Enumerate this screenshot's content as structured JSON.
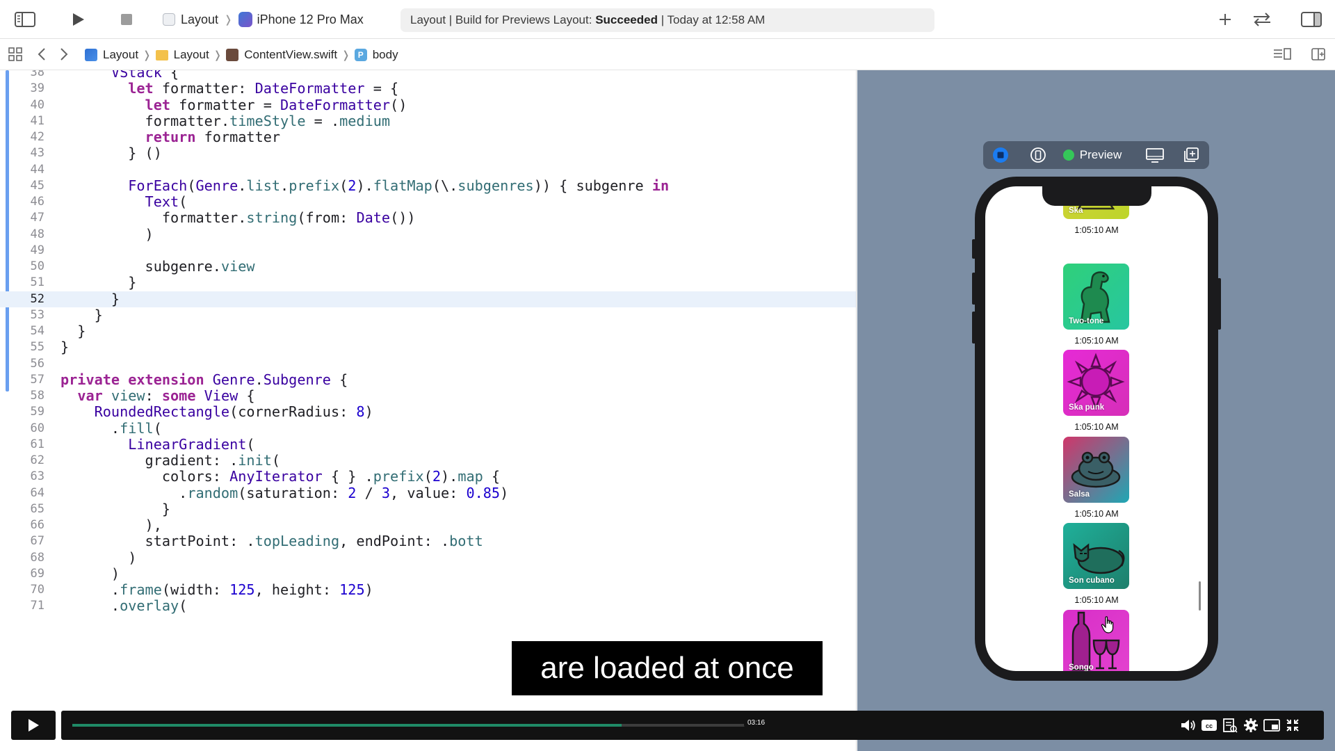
{
  "toolbar": {
    "scheme": "Layout",
    "device": "iPhone 12 Pro Max",
    "activity_prefix": "Layout | Build for Previews Layout:",
    "activity_status": "Succeeded",
    "activity_suffix": "| Today at 12:58 AM"
  },
  "jumpbar": {
    "crumbs": [
      "Layout",
      "Layout",
      "ContentView.swift",
      "body"
    ]
  },
  "editor": {
    "current_line": 52,
    "lines": [
      {
        "n": "38",
        "t": "      VStack {"
      },
      {
        "n": "39",
        "t": "        let formatter: DateFormatter = {"
      },
      {
        "n": "40",
        "t": "          let formatter = DateFormatter()"
      },
      {
        "n": "41",
        "t": "          formatter.timeStyle = .medium"
      },
      {
        "n": "42",
        "t": "          return formatter"
      },
      {
        "n": "43",
        "t": "        } ()"
      },
      {
        "n": "44",
        "t": ""
      },
      {
        "n": "45",
        "t": "        ForEach(Genre.list.prefix(2).flatMap(\\.subgenres)) { subgenre in"
      },
      {
        "n": "46",
        "t": "          Text("
      },
      {
        "n": "47",
        "t": "            formatter.string(from: Date())"
      },
      {
        "n": "48",
        "t": "          )"
      },
      {
        "n": "49",
        "t": ""
      },
      {
        "n": "50",
        "t": "          subgenre.view"
      },
      {
        "n": "51",
        "t": "        }"
      },
      {
        "n": "52",
        "t": "      }"
      },
      {
        "n": "53",
        "t": "    }"
      },
      {
        "n": "54",
        "t": "  }"
      },
      {
        "n": "55",
        "t": "}"
      },
      {
        "n": "56",
        "t": ""
      },
      {
        "n": "57",
        "t": "private extension Genre.Subgenre {"
      },
      {
        "n": "58",
        "t": "  var view: some View {"
      },
      {
        "n": "59",
        "t": "    RoundedRectangle(cornerRadius: 8)"
      },
      {
        "n": "60",
        "t": "      .fill("
      },
      {
        "n": "61",
        "t": "        LinearGradient("
      },
      {
        "n": "62",
        "t": "          gradient: .init("
      },
      {
        "n": "63",
        "t": "            colors: AnyIterator { } .prefix(2).map {"
      },
      {
        "n": "64",
        "t": "              .random(saturation: 2 / 3, value: 0.85)"
      },
      {
        "n": "65",
        "t": "            }"
      },
      {
        "n": "66",
        "t": "          ),"
      },
      {
        "n": "67",
        "t": "          startPoint: .topLeading, endPoint: .bott"
      },
      {
        "n": "68",
        "t": "        )"
      },
      {
        "n": "69",
        "t": "      )"
      },
      {
        "n": "70",
        "t": "      .frame(width: 125, height: 125)"
      },
      {
        "n": "71",
        "t": "      .overlay("
      }
    ]
  },
  "preview": {
    "toolbar_label": "Preview",
    "tiles": [
      {
        "label": "Ska",
        "time": "1:05:10 AM",
        "colors": [
          "#d4d13a",
          "#bdd52a"
        ],
        "icon": "pine-tree-icon"
      },
      {
        "label": "Two-tone",
        "time": "1:05:10 AM",
        "colors": [
          "#2fd07a",
          "#27c6a0"
        ],
        "icon": "dinosaur-icon"
      },
      {
        "label": "Ska punk",
        "time": "1:05:10 AM",
        "colors": [
          "#e62ad6",
          "#d62fb8"
        ],
        "icon": "sun-icon"
      },
      {
        "label": "Salsa",
        "time": "1:05:10 AM",
        "colors": [
          "#d0366a",
          "#1fa7b4"
        ],
        "icon": "frog-icon"
      },
      {
        "label": "Son cubano",
        "time": "1:05:10 AM",
        "colors": [
          "#1fb09a",
          "#1e7f6c"
        ],
        "icon": "cat-icon"
      },
      {
        "label": "Songo",
        "time": "",
        "colors": [
          "#d82ec8",
          "#e342cf"
        ],
        "icon": "wine-icon"
      }
    ]
  },
  "caption": "are loaded at once",
  "video": {
    "timestamp": "03:16",
    "progress": 0.79
  }
}
